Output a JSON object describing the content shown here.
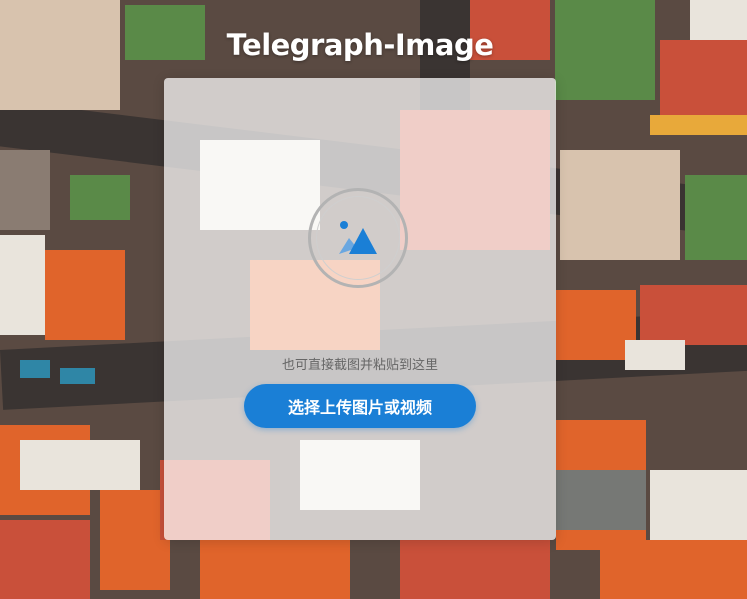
{
  "app": {
    "title": "Telegraph-Image"
  },
  "uploader": {
    "icon": "image-upload-icon",
    "hint": "也可直接截图并粘贴到这里",
    "button_label": "选择上传图片或视频"
  },
  "colors": {
    "accent": "#1a7fd6",
    "title_text": "#ffffff",
    "hint_text": "#666666"
  }
}
